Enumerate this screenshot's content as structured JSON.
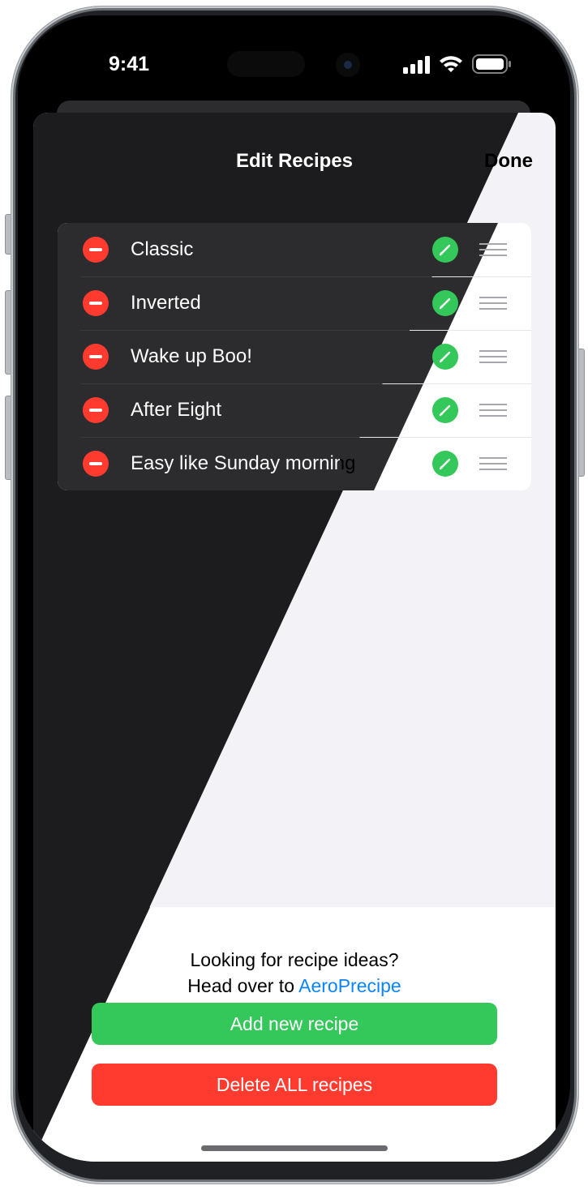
{
  "status_bar": {
    "time": "9:41"
  },
  "nav": {
    "title": "Edit Recipes",
    "done_label": "Done"
  },
  "recipes": [
    {
      "name": "Classic"
    },
    {
      "name": "Inverted"
    },
    {
      "name": "Wake up Boo!"
    },
    {
      "name": "After Eight"
    },
    {
      "name": "Easy like Sunday morning"
    }
  ],
  "footer": {
    "prompt_line1": "Looking for recipe ideas?",
    "prompt_line2_prefix": "Head over to ",
    "link_text": "AeroPrecipe",
    "add_button": "Add new recipe",
    "delete_button": "Delete ALL recipes"
  },
  "colors": {
    "delete_red": "#ff3b30",
    "edit_green": "#34c759",
    "link_blue": "#0a84ff",
    "dark_background": "#1c1c1e",
    "light_background": "#f2f2f7"
  },
  "icons": [
    "minus-circle-icon",
    "pencil-icon",
    "drag-handle-icon",
    "cellular-icon",
    "wifi-icon",
    "battery-icon"
  ]
}
